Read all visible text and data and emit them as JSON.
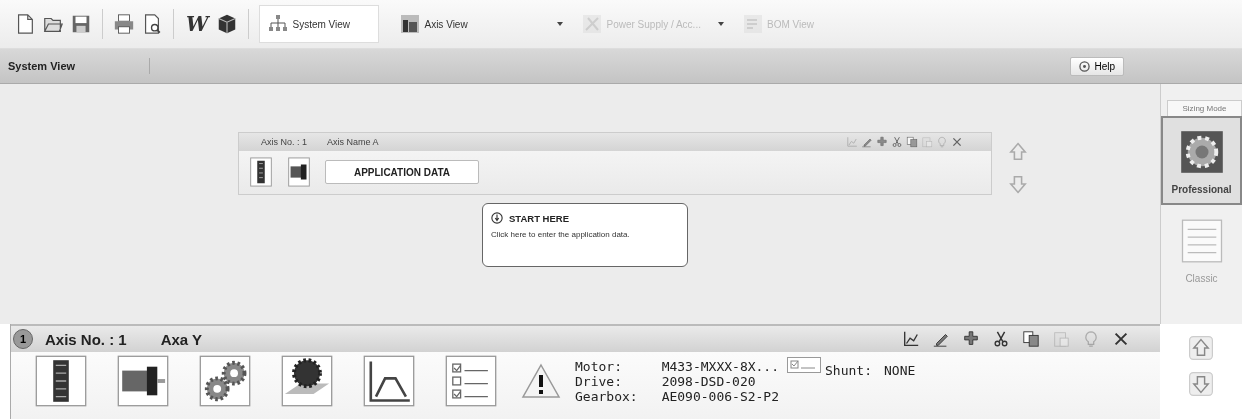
{
  "toolbar": {
    "icons": [
      {
        "kind": "new"
      },
      {
        "kind": "open"
      },
      {
        "kind": "save"
      },
      {
        "kind": "print"
      },
      {
        "kind": "preview"
      },
      {
        "kind": "word",
        "label": "W"
      },
      {
        "kind": "cube"
      }
    ],
    "views": [
      {
        "label": "System View",
        "kind": "system",
        "selected": true,
        "disabled": false,
        "dropdown": false
      },
      {
        "label": "Axis View",
        "kind": "axis",
        "selected": false,
        "disabled": false,
        "dropdown": true
      },
      {
        "label": "Power Supply / Acc...",
        "kind": "power",
        "selected": false,
        "disabled": true,
        "dropdown": true
      },
      {
        "label": "BOM View",
        "kind": "bom",
        "selected": false,
        "disabled": true,
        "dropdown": false
      }
    ]
  },
  "title_bar": {
    "title": "System View",
    "help": "Help"
  },
  "sizing_mode": {
    "title": "Sizing Mode",
    "modes": [
      {
        "label": "Professional",
        "kind": "gear",
        "selected": true
      },
      {
        "label": "Classic",
        "kind": "sheet",
        "selected": false
      }
    ]
  },
  "axis_card": {
    "axis_no": "Axis No. : 1",
    "axis_name": "Axis Name A",
    "tools": [
      {
        "kind": "chart",
        "disabled": true
      },
      {
        "kind": "edit",
        "disabled": false
      },
      {
        "kind": "add",
        "disabled": false
      },
      {
        "kind": "cut",
        "disabled": false
      },
      {
        "kind": "copy",
        "disabled": false
      },
      {
        "kind": "paste",
        "disabled": true
      },
      {
        "kind": "bulb",
        "disabled": true
      },
      {
        "kind": "close",
        "disabled": false
      }
    ],
    "button": "APPLICATION DATA",
    "tooltip": {
      "title": "START HERE",
      "text": "Click here to enter the application data."
    }
  },
  "axis_panel": {
    "badge": "1",
    "axis_no": "Axis No. : 1",
    "axis_name": "Axa Y",
    "tools": [
      {
        "kind": "chart",
        "disabled": false
      },
      {
        "kind": "edit",
        "disabled": false
      },
      {
        "kind": "add",
        "disabled": false
      },
      {
        "kind": "cut",
        "disabled": false
      },
      {
        "kind": "copy",
        "disabled": false
      },
      {
        "kind": "paste",
        "disabled": true
      },
      {
        "kind": "bulb",
        "disabled": true
      },
      {
        "kind": "close",
        "disabled": false
      }
    ],
    "steps": [
      {
        "kind": "drive"
      },
      {
        "kind": "motor"
      },
      {
        "kind": "gears"
      },
      {
        "kind": "conveyor"
      },
      {
        "kind": "profile"
      },
      {
        "kind": "checklist"
      }
    ],
    "info": [
      {
        "label": "Motor:",
        "value": "M433-MXXX-8X..."
      },
      {
        "label": "Drive:",
        "value": "2098-DSD-020"
      },
      {
        "label": "Gearbox:",
        "value": "AE090-006-S2-P2"
      }
    ],
    "shunt": {
      "label": "Shunt:",
      "value": "NONE"
    }
  }
}
